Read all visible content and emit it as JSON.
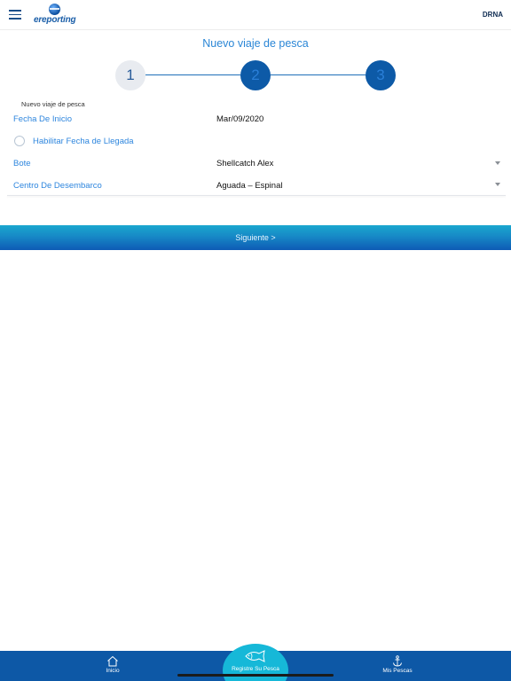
{
  "header": {
    "menu_icon": "hamburger-menu-icon",
    "logo_text": "ereporting",
    "right_label": "DRNA"
  },
  "page": {
    "title": "Nuevo viaje de pesca"
  },
  "stepper": {
    "steps": [
      "1",
      "2",
      "3"
    ],
    "current_step": 2
  },
  "form": {
    "section_title": "Nuevo viaje de pesca",
    "fecha_inicio": {
      "label": "Fecha De Inicio",
      "value": "Mar/09/2020"
    },
    "habilitar_llegada": {
      "label": "Habilitar Fecha de Llegada",
      "checked": false
    },
    "bote": {
      "label": "Bote",
      "value": "Shellcatch Alex"
    },
    "centro": {
      "label": "Centro De Desembarco",
      "value": "Aguada – Espinal"
    }
  },
  "actions": {
    "next_label": "Siguiente >"
  },
  "bottom_nav": {
    "inicio": {
      "label": "Inicio",
      "icon": "home-icon"
    },
    "registre": {
      "label": "Registre Su Pesca",
      "icon": "fish-icon"
    },
    "mis_pescas": {
      "label": "Mis Pescas",
      "icon": "anchor-icon"
    }
  },
  "colors": {
    "primary": "#0d58a6",
    "accent": "#16b8d8",
    "label_blue": "#2e86de"
  }
}
